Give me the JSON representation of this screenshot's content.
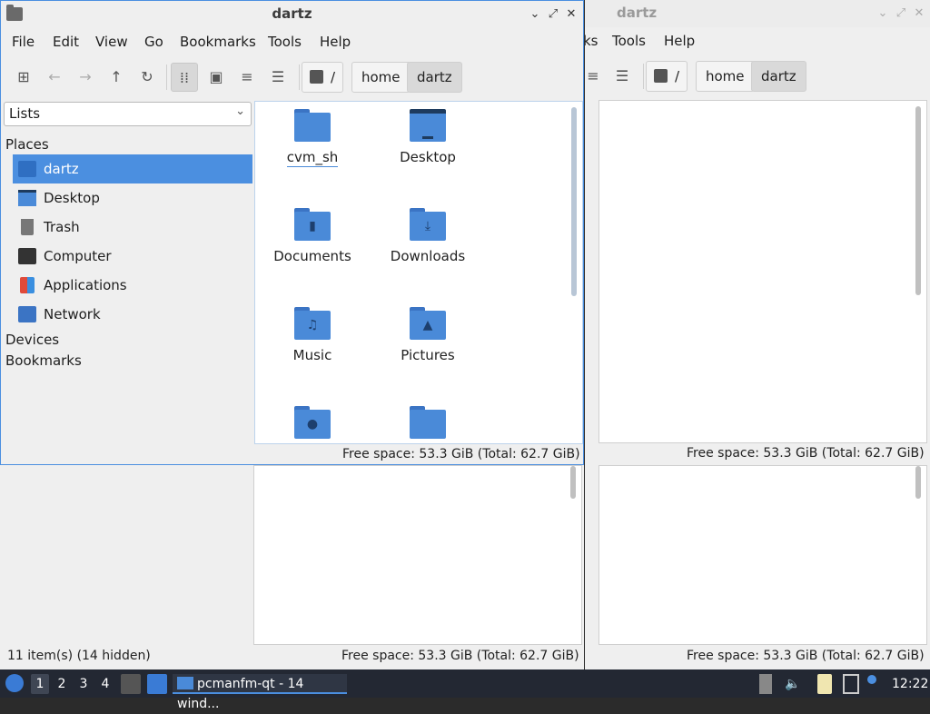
{
  "window": {
    "title": "dartz",
    "min_glyph": "⌄",
    "max_glyph": "⤢",
    "close_glyph": "✕"
  },
  "menu": [
    "File",
    "Edit",
    "View",
    "Go",
    "Bookmarks",
    "Tools",
    "Help"
  ],
  "breadcrumb": {
    "root": "/",
    "home": "home",
    "current": "dartz"
  },
  "side_combo": {
    "value": "Lists",
    "chevron": "⌄"
  },
  "sidebar": {
    "places_label": "Places",
    "items": [
      {
        "label": "dartz",
        "icon": "home-folder-icon"
      },
      {
        "label": "Desktop",
        "icon": "desktop-icon"
      },
      {
        "label": "Trash",
        "icon": "trash-icon"
      },
      {
        "label": "Computer",
        "icon": "computer-icon"
      },
      {
        "label": "Applications",
        "icon": "applications-icon"
      },
      {
        "label": "Network",
        "icon": "network-icon"
      }
    ],
    "devices_label": "Devices",
    "bookmarks_label": "Bookmarks"
  },
  "files": [
    "cvm_sh",
    "Desktop",
    "Documents",
    "Downloads",
    "Music",
    "Pictures"
  ],
  "status": {
    "free_space": "Free space: 53.3 GiB (Total: 62.7 GiB)",
    "items": "11 item(s) (14 hidden)"
  },
  "bg_menu": {
    "tools": "Tools",
    "help": "Help",
    "ks": "ks"
  },
  "taskbar": {
    "desktops": [
      "1",
      "2",
      "3",
      "4"
    ],
    "task_label": "pcmanfm-qt - 14 wind...",
    "clock": "12:22"
  },
  "colors": {
    "accent": "#4b8fe0",
    "folder": "#4a8ad8",
    "taskbar": "#232833"
  }
}
